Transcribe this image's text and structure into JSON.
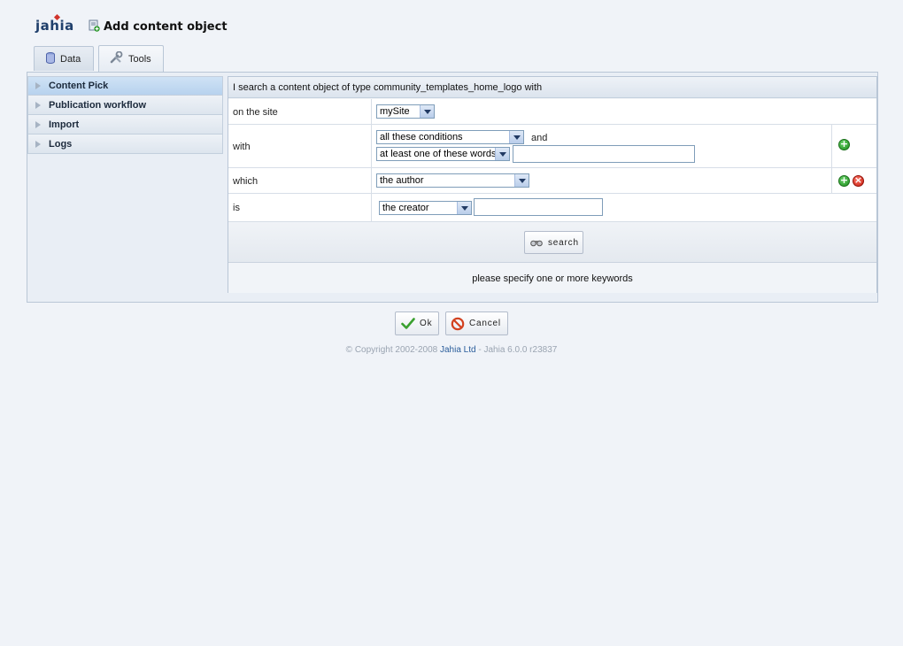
{
  "app": {
    "logo_text": "jahia",
    "title": "Add content object"
  },
  "tabs": [
    {
      "label": "Data",
      "icon": "database-icon"
    },
    {
      "label": "Tools",
      "icon": "wrench-icon",
      "active": true
    }
  ],
  "sidebar": {
    "items": [
      {
        "label": "Content Pick",
        "active": true
      },
      {
        "label": "Publication workflow"
      },
      {
        "label": "Import"
      },
      {
        "label": "Logs"
      }
    ]
  },
  "search_form": {
    "header": "I search a content object of type community_templates_home_logo with",
    "rows": {
      "site": {
        "label": "on the site",
        "value": "mySite"
      },
      "with": {
        "label": "with",
        "conditions": "all these conditions",
        "and_text": "and",
        "word_mode": "at least one of these words",
        "keywords_value": ""
      },
      "which": {
        "label": "which",
        "value": "the author"
      },
      "is": {
        "label": "is",
        "value": "the creator",
        "text_value": ""
      }
    },
    "search_button": "search",
    "status_message": "please specify one or more keywords"
  },
  "footer_buttons": {
    "ok": "Ok",
    "cancel": "Cancel"
  },
  "copyright": {
    "prefix": "© Copyright 2002-2008 ",
    "brand": "Jahia Ltd",
    "suffix": " - Jahia 6.0.0 r23837"
  },
  "colors": {
    "background": "#f0f3f8",
    "accent": "#1f3f6b",
    "add": "#1b8b1b",
    "remove": "#c4190c",
    "brand_link": "#2a5d9b"
  }
}
